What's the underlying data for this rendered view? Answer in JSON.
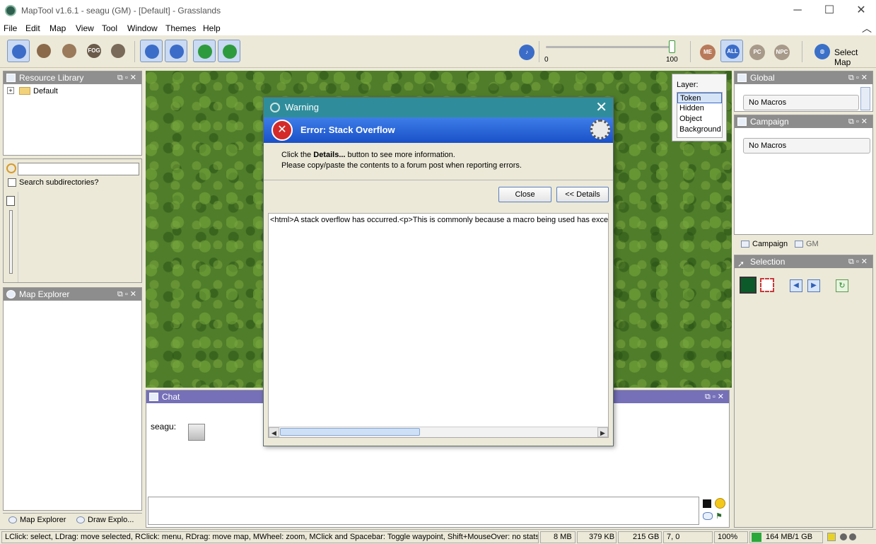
{
  "window": {
    "title": "MapTool v1.6.1 - seagu (GM) - [Default] - Grasslands",
    "minimize": "─",
    "maximize": "☐",
    "close": "✕"
  },
  "menu": [
    "File",
    "Edit",
    "Map",
    "View",
    "Tool",
    "Window",
    "Themes",
    "Help"
  ],
  "toolbar": {
    "fog_label": "FOG",
    "slider_min": "0",
    "slider_max": "100",
    "slider_value": 1.0,
    "visibility_buttons": [
      "ME",
      "ALL",
      "PC",
      "NPC"
    ],
    "select_map_label": "Select Map"
  },
  "resource_library": {
    "title": "Resource Library",
    "tree_item": "Default",
    "search_placeholder": "",
    "search_subdirs_label": "Search subdirectories?"
  },
  "map_explorer": {
    "title": "Map Explorer"
  },
  "left_tabs": [
    "Map Explorer",
    "Draw Explo..."
  ],
  "layer": {
    "label": "Layer:",
    "items": [
      "Token",
      "Hidden",
      "Object",
      "Background"
    ],
    "selected": "Token"
  },
  "global_panel": {
    "title": "Global",
    "content": "No Macros"
  },
  "campaign_panel": {
    "title": "Campaign",
    "content": "No Macros"
  },
  "right_tabs": [
    "Campaign",
    "GM"
  ],
  "selection_panel": {
    "title": "Selection"
  },
  "chat": {
    "title": "Chat",
    "sender": "seagu:",
    "input_value": ""
  },
  "dialog": {
    "title": "Warning",
    "heading": "Error: Stack Overflow",
    "line1_pre": "Click the ",
    "line1_bold": "Details...",
    "line1_post": " button to see more information.",
    "line2": "Please copy/paste the contents to a forum post when reporting errors.",
    "close_label": "Close",
    "details_label": "<< Details",
    "details_text": "<html>A stack overflow has occurred.<p>This is commonly because a macro being used has excee"
  },
  "statusbar": {
    "hint": "LClick: select, LDrag: move selected, RClick: menu, RDrag: move map, MWheel: zoom, MClick and Spacebar: Toggle waypoint, Shift+MouseOver: no statsh...",
    "mem1": "8 MB",
    "mem2": "379 KB",
    "disk": "215 GB",
    "coords": "7, 0",
    "zoom": "100%",
    "heap": "164 MB/1 GB"
  }
}
